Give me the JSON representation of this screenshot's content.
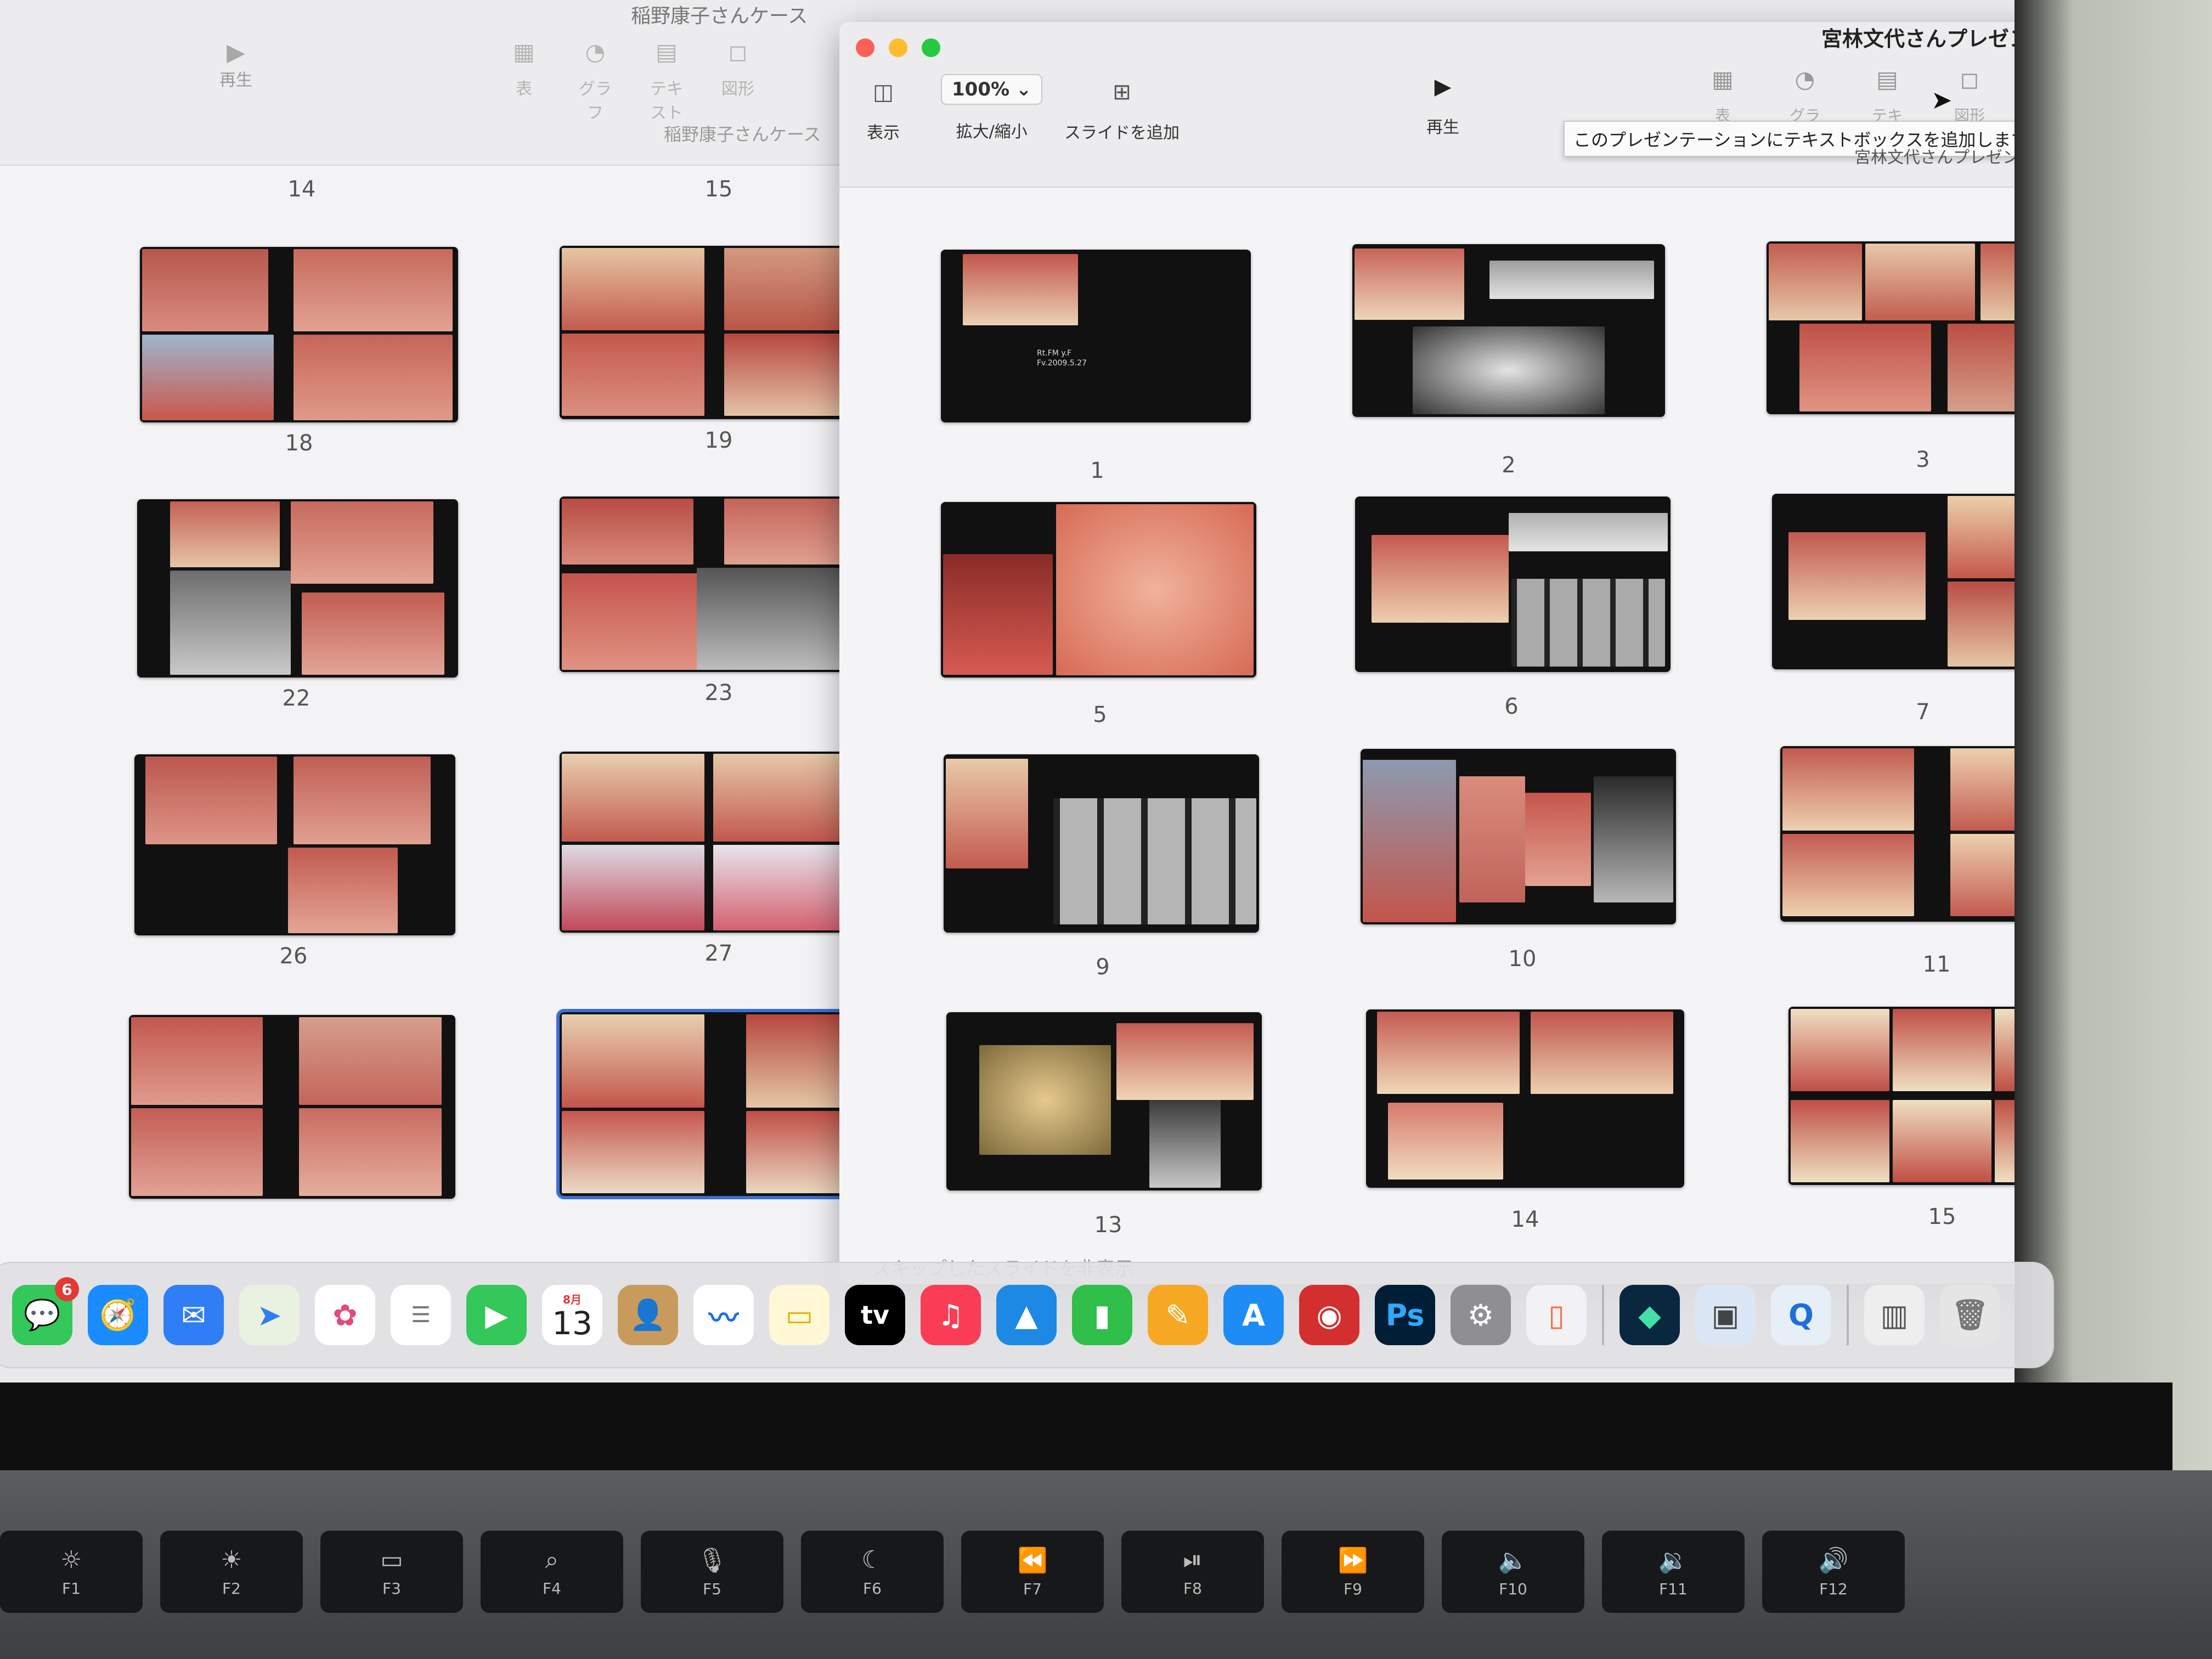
{
  "back_window": {
    "title": "稲野康子さんケース",
    "subtitle": "稲野康子さんケース",
    "play_label": "再生",
    "tools": [
      {
        "label": "表",
        "icon": "table-icon"
      },
      {
        "label": "グラフ",
        "icon": "chart-icon"
      },
      {
        "label": "テキスト",
        "icon": "text-icon"
      },
      {
        "label": "図形",
        "icon": "shape-icon"
      }
    ],
    "slide_numbers": [
      "14",
      "15",
      "18",
      "19",
      "22",
      "23",
      "26",
      "27"
    ]
  },
  "front_window": {
    "title": "宮林文代さんプレゼン",
    "subtitle": "宮林文代さんプレゼン",
    "view_label": "表示",
    "zoom_value": "100%",
    "zoom_label": "拡大/縮小",
    "add_slide_label": "スライドを追加",
    "play_label": "再生",
    "tools": [
      {
        "label": "表",
        "icon": "table-icon"
      },
      {
        "label": "グラフ",
        "icon": "chart-icon"
      },
      {
        "label": "テキスト",
        "icon": "text-icon"
      },
      {
        "label": "図形",
        "icon": "shape-icon"
      }
    ],
    "tooltip": "このプレゼンテーションにテキストボックスを追加します。",
    "slide_numbers": [
      "1",
      "2",
      "3",
      "5",
      "6",
      "7",
      "9",
      "10",
      "11",
      "13",
      "14",
      "15"
    ],
    "skipped_hint": "スキップしたスライドを非表示"
  },
  "dock": {
    "messages_badge": "6",
    "calendar_month": "8月",
    "calendar_day": "13",
    "tv_label": "tv",
    "ps_label": "Ps"
  },
  "keyboard": {
    "keys": [
      "F1",
      "F2",
      "F3",
      "F4",
      "F5",
      "F6",
      "F7",
      "F8",
      "F9",
      "F10",
      "F11",
      "F12"
    ]
  }
}
